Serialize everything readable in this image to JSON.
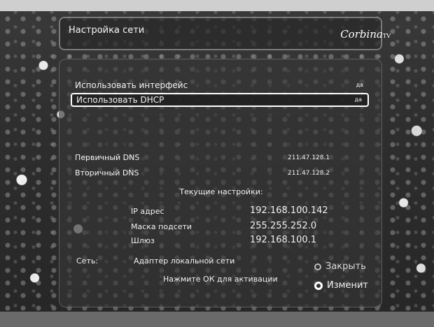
{
  "header": {
    "title": "Настройка сети",
    "logo": "Corbina",
    "logo_suffix": "TV"
  },
  "settings": [
    {
      "label": "Использовать интерфейс",
      "value": "да",
      "selected": false
    },
    {
      "label": "Использовать DHCP",
      "value": "да",
      "selected": true
    }
  ],
  "dns": [
    {
      "label": "Первичный DNS",
      "value": "211.47.128.1"
    },
    {
      "label": "Вторичный DNS",
      "value": "211.47.128.2"
    }
  ],
  "current": {
    "title": "Текущие настройки:",
    "rows": [
      {
        "key": "IP адрес",
        "value": "192.168.100.142"
      },
      {
        "key": "Маска подсети",
        "value": "255.255.252.0"
      },
      {
        "key": "Шлюз",
        "value": "192.168.100.1"
      }
    ]
  },
  "network": {
    "label": "Сеть:",
    "adapter": "Адаптер локальной сети"
  },
  "hint": "Нажмите ОК для активации",
  "actions": {
    "close": "Закрыть",
    "change": "Изменит"
  }
}
